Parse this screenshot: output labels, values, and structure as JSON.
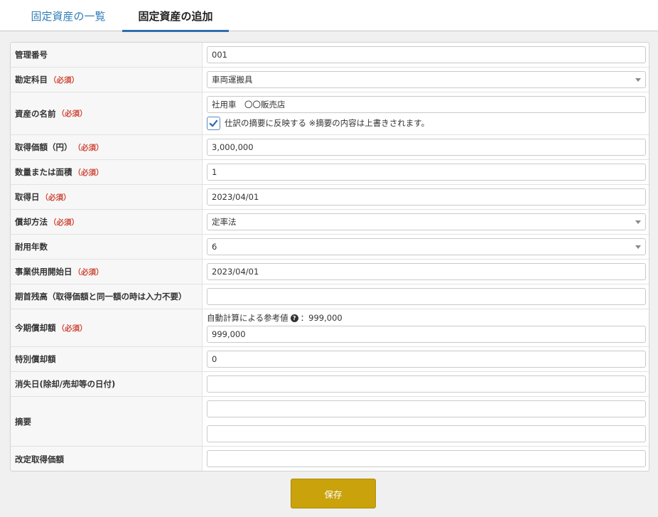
{
  "tabs": {
    "list_label": "固定資産の一覧",
    "add_label": "固定資産の追加"
  },
  "required_label": "（必須）",
  "form": {
    "management_number": {
      "label": "管理番号",
      "value": "001"
    },
    "account_title": {
      "label": "勘定科目",
      "value": "車両運搬具"
    },
    "asset_name": {
      "label": "資産の名前",
      "value": "社用車　〇〇販売店",
      "checkbox_label": "仕訳の摘要に反映する ※摘要の内容は上書きされます。",
      "checked": true
    },
    "acquisition_price": {
      "label": "取得価額（円）",
      "value": "3,000,000"
    },
    "quantity": {
      "label": "数量または面積",
      "value": "1"
    },
    "acquisition_date": {
      "label": "取得日",
      "value": "2023/04/01"
    },
    "depreciation_method": {
      "label": "償却方法",
      "value": "定率法"
    },
    "useful_life": {
      "label": "耐用年数",
      "value": "6"
    },
    "service_start_date": {
      "label": "事業供用開始日",
      "value": "2023/04/01"
    },
    "opening_balance": {
      "label": "期首残高（取得価額と同一額の時は入力不要）",
      "value": ""
    },
    "current_depreciation": {
      "label": "今期償却額",
      "hint_text": "自動計算による参考値",
      "hint_value": "：999,000",
      "value": "999,000"
    },
    "special_depreciation": {
      "label": "特別償却額",
      "value": "0"
    },
    "disposal_date": {
      "label": "消失日(除却/売却等の日付)",
      "value": ""
    },
    "summary": {
      "label": "摘要",
      "value_1": "",
      "value_2": ""
    },
    "revised_acquisition_price": {
      "label": "改定取得価額",
      "value": ""
    }
  },
  "save_label": "保存",
  "colors": {
    "accent_blue": "#2f7db8",
    "required_red": "#d04a3a",
    "save_button": "#c9a20c"
  }
}
